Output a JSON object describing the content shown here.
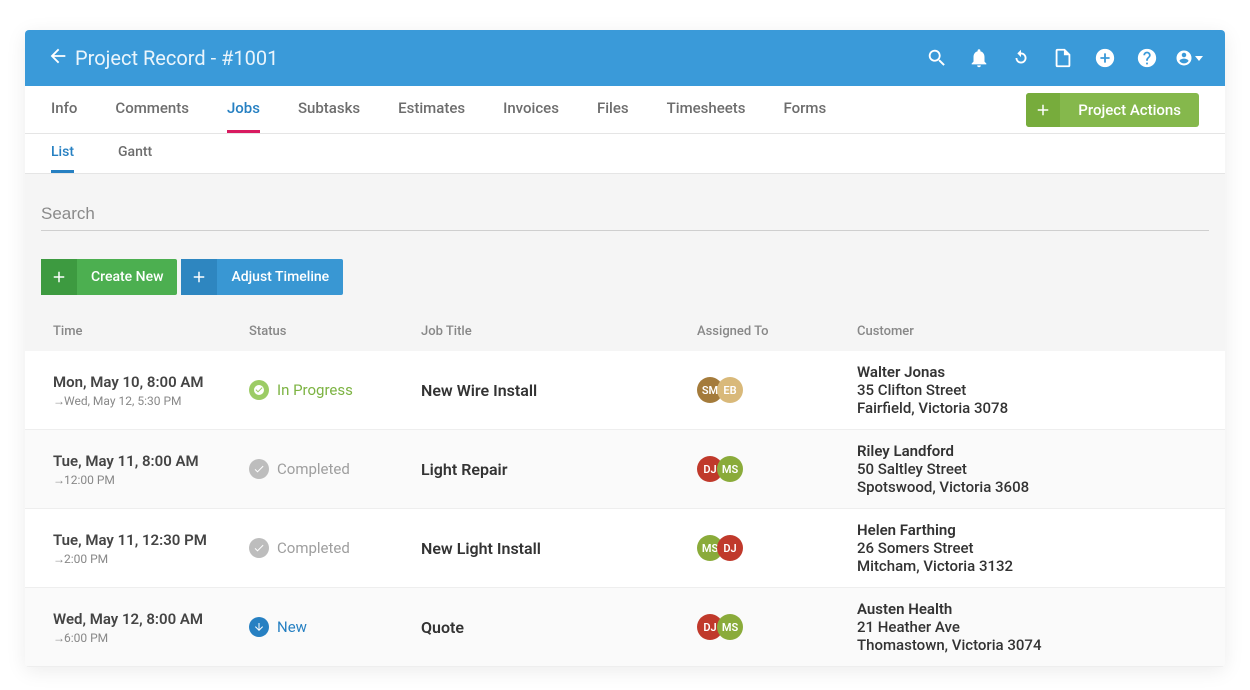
{
  "header": {
    "title": "Project Record - #1001"
  },
  "tabs": {
    "items": [
      "Info",
      "Comments",
      "Jobs",
      "Subtasks",
      "Estimates",
      "Invoices",
      "Files",
      "Timesheets",
      "Forms"
    ],
    "active_index": 2,
    "project_actions_label": "Project Actions"
  },
  "subtabs": {
    "items": [
      "List",
      "Gantt"
    ],
    "active_index": 0
  },
  "search": {
    "placeholder": "Search"
  },
  "buttons": {
    "create_new": "Create New",
    "adjust_timeline": "Adjust Timeline"
  },
  "columns": [
    "Time",
    "Status",
    "Job Title",
    "Assigned To",
    "Customer"
  ],
  "status_labels": {
    "in_progress": "In Progress",
    "completed": "Completed",
    "new": "New"
  },
  "jobs": [
    {
      "time_primary": "Mon, May 10, 8:00 AM",
      "time_secondary": "Wed, May 12, 5:30 PM",
      "status": "in_progress",
      "title": "New Wire Install",
      "assigned": [
        {
          "initials": "SM",
          "color": "brown"
        },
        {
          "initials": "EB",
          "color": "tan"
        }
      ],
      "customer_name": "Walter Jonas",
      "customer_line1": "35 Clifton Street",
      "customer_line2": "Fairfield, Victoria 3078"
    },
    {
      "time_primary": "Tue, May 11, 8:00 AM",
      "time_secondary": "12:00 PM",
      "status": "completed",
      "title": "Light Repair",
      "assigned": [
        {
          "initials": "DJ",
          "color": "red"
        },
        {
          "initials": "MS",
          "color": "olive"
        }
      ],
      "customer_name": "Riley Landford",
      "customer_line1": "50 Saltley Street",
      "customer_line2": "Spotswood, Victoria 3608"
    },
    {
      "time_primary": "Tue, May 11, 12:30 PM",
      "time_secondary": "2:00 PM",
      "status": "completed",
      "title": "New Light Install",
      "assigned": [
        {
          "initials": "MS",
          "color": "olive"
        },
        {
          "initials": "DJ",
          "color": "red"
        }
      ],
      "customer_name": "Helen Farthing",
      "customer_line1": "26 Somers Street",
      "customer_line2": "Mitcham, Victoria 3132"
    },
    {
      "time_primary": "Wed, May 12, 8:00 AM",
      "time_secondary": "6:00 PM",
      "status": "new",
      "title": "Quote",
      "assigned": [
        {
          "initials": "DJ",
          "color": "red"
        },
        {
          "initials": "MS",
          "color": "olive"
        }
      ],
      "customer_name": "Austen Health",
      "customer_line1": "21 Heather Ave",
      "customer_line2": "Thomastown, Victoria 3074"
    }
  ]
}
